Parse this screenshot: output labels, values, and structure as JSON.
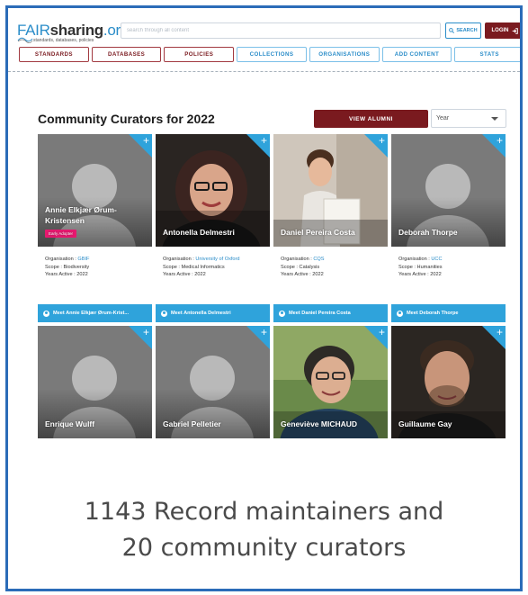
{
  "header": {
    "logo": {
      "fair": "FAIR",
      "sharing": "sharing",
      "org": ".org",
      "tagline": "standards, databases, policies"
    },
    "search_placeholder": "search through all content",
    "search_button": "SEARCH",
    "login_button": "LOGIN"
  },
  "nav": [
    {
      "label": "STANDARDS",
      "style": "red"
    },
    {
      "label": "DATABASES",
      "style": "red"
    },
    {
      "label": "POLICIES",
      "style": "red"
    },
    {
      "label": "COLLECTIONS",
      "style": "blue"
    },
    {
      "label": "ORGANISATIONS",
      "style": "blue"
    },
    {
      "label": "ADD CONTENT",
      "style": "blue"
    },
    {
      "label": "STATS",
      "style": "blue"
    }
  ],
  "main": {
    "title": "Community Curators for 2022",
    "view_alumni": "VIEW ALUMNI",
    "year_select": "Year"
  },
  "curators": [
    {
      "name": "Annie Elkjær Ørum-Kristensen",
      "badge": "Early Adopter",
      "organisation": "GBIF",
      "scope": "Biodiversity",
      "years": "2022",
      "meet": "Meet Annie Elkjær Ørum-Krist...",
      "photo": "placeholder"
    },
    {
      "name": "Antonella Delmestri",
      "organisation": "University of Oxford",
      "scope": "Medical Informatics",
      "years": "2022",
      "meet": "Meet Antonella Delmestri",
      "photo": "woman-glasses"
    },
    {
      "name": "Daniel Pereira Costa",
      "organisation": "CQS",
      "scope": "Catalysis",
      "years": "2022",
      "meet": "Meet Daniel Pereira Costa",
      "photo": "young-man"
    },
    {
      "name": "Deborah Thorpe",
      "organisation": "UCC",
      "scope": "Humanities",
      "years": "2022",
      "meet": "Meet Deborah Thorpe",
      "photo": "placeholder"
    },
    {
      "name": "Enrique Wulff",
      "photo": "placeholder"
    },
    {
      "name": "Gabriel Pelletier",
      "photo": "placeholder"
    },
    {
      "name": "Geneviève MICHAUD",
      "photo": "woman-short-hair"
    },
    {
      "name": "Guillaume Gay",
      "photo": "man-beard"
    }
  ],
  "labels": {
    "organisation": "Organisation : ",
    "scope": "Scope : ",
    "years": "Years Active : "
  },
  "caption": {
    "line1": "1143 Record maintainers and",
    "line2": "20 community curators"
  },
  "colors": {
    "frame": "#2b6cb8",
    "brand_red": "#7a1a1f",
    "accent_blue": "#2fa3db",
    "badge_pink": "#e6196f"
  }
}
